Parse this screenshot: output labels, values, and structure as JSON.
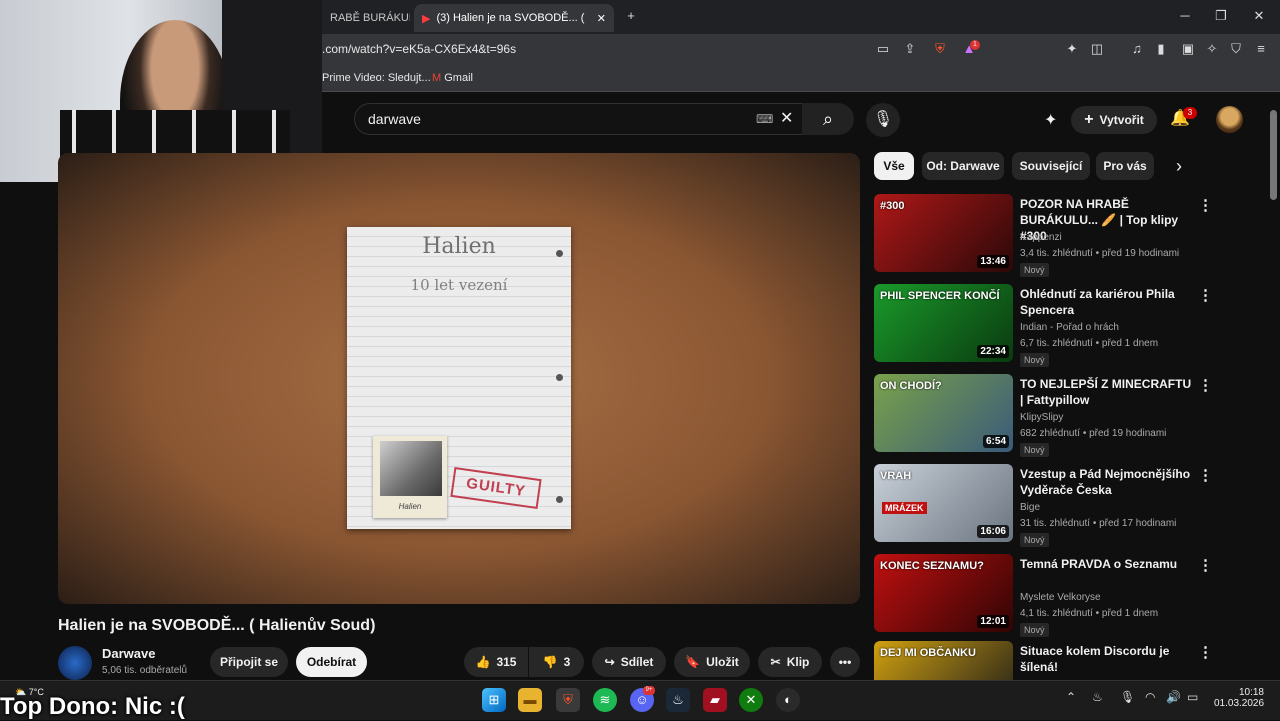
{
  "browser": {
    "tabs": [
      {
        "title": "RABĚ BURÁKULU...",
        "active": false
      },
      {
        "title": "(3) Halien je na SVOBODĚ... (",
        "active": true
      }
    ],
    "url": ".com/watch?v=eK5a-CX6Ex4&t=96s",
    "bookmarks": [
      {
        "label": "Prime Video: Sledujt..."
      },
      {
        "label": "Gmail"
      }
    ],
    "ext_badge": "1"
  },
  "yt_header": {
    "search_value": "darwave",
    "create_label": "Vytvořit",
    "notif_count": "3"
  },
  "video": {
    "paper_name": "Halien",
    "paper_sub": "10 let vezení",
    "photo_caption": "Halien",
    "stamp": "GUILTY",
    "title": "Halien je na SVOBODĚ... ( Halienův Soud)",
    "channel": "Darwave",
    "subscribers": "5,06 tis. odběratelů",
    "join_label": "Připojit se",
    "subscribe_label": "Odebírat",
    "likes": "315",
    "dislikes": "3",
    "share_label": "Sdílet",
    "save_label": "Uložit",
    "clip_label": "Klip"
  },
  "chips": [
    "Vše",
    "Od: Darwave",
    "Související",
    "Pro vás"
  ],
  "recommendations": [
    {
      "title": "POZOR NA HRABĚ BURÁKULU... 🥖 | Top klipy #300",
      "channel": "Kappenzi",
      "meta": "3,4 tis. zhlédnutí • před 19 hodinami",
      "badge": "Nový",
      "duration": "13:46",
      "overlay": "#300",
      "colors": [
        "#b01818",
        "#2a0808"
      ]
    },
    {
      "title": "Ohlédnutí za kariérou Phila Spencera",
      "channel": "Indian - Pořad o hrách",
      "meta": "6,7 tis. zhlédnutí • před 1 dnem",
      "badge": "Nový",
      "duration": "22:34",
      "overlay": "PHIL SPENCER KONČÍ",
      "colors": [
        "#1a9a2a",
        "#0a3a10"
      ]
    },
    {
      "title": "TO NEJLEPŠÍ Z MINECRAFTU | Fattypillow",
      "channel": "KlipySlipy",
      "meta": "682 zhlédnutí • před 19 hodinami",
      "badge": "Nový",
      "duration": "6:54",
      "overlay": "ON CHODÍ?",
      "colors": [
        "#7aa24a",
        "#3a5a7a"
      ]
    },
    {
      "title": "Vzestup a Pád Nejmocnějšího Vyděrače Česka",
      "channel": "Bige",
      "meta": "31 tis. zhlédnutí • před 17 hodinami",
      "badge": "Nový",
      "duration": "16:06",
      "overlay": "VRAH",
      "overlay2": "MRÁZEK",
      "colors": [
        "#c9d0d8",
        "#6a7480"
      ]
    },
    {
      "title": "Temná PRAVDA o Seznamu",
      "channel": "Myslete Velkoryse",
      "meta": "4,1 tis. zhlédnutí • před 1 dnem",
      "badge": "Nový",
      "duration": "12:01",
      "overlay": "KONEC SEZNAMU?",
      "colors": [
        "#c01010",
        "#300404"
      ]
    },
    {
      "title": "Situace kolem Discordu je šílená!",
      "channel": "",
      "meta": "",
      "badge": "",
      "duration": "",
      "overlay": "DEJ MI OBČANKU",
      "colors": [
        "#d0a010",
        "#1a1a1a"
      ]
    }
  ],
  "taskbar": {
    "overlay_text": "Top Dono: Nic :(",
    "weather_temp": "7°C",
    "time": "10:18",
    "date": "01.03.2026",
    "discord_badge": "9+"
  }
}
